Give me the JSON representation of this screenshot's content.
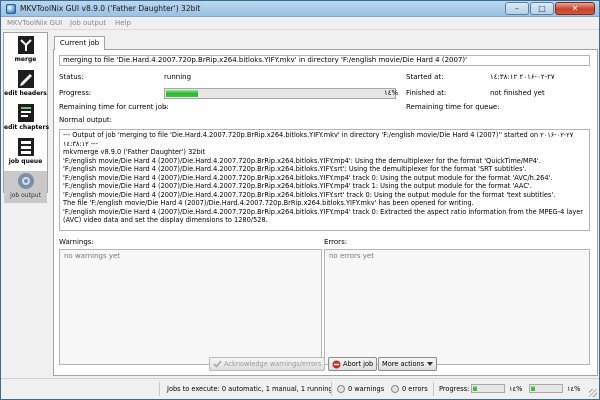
{
  "window": {
    "title": "MKVToolNix GUI v8.9.0 ('Father Daughter') 32bit",
    "minimize_glyph": "–",
    "maximize_glyph": "□",
    "close_glyph": "✕"
  },
  "menu": [
    "MKVToolNix GUI",
    "Job output",
    "Help"
  ],
  "sidebar": [
    {
      "label": "merge",
      "icon": "merge-icon"
    },
    {
      "label": "edit headers",
      "icon": "edit-headers-icon"
    },
    {
      "label": "edit chapters",
      "icon": "edit-chapters-icon"
    },
    {
      "label": "job queue",
      "icon": "job-queue-icon"
    },
    {
      "label": "job output",
      "icon": "job-output-icon",
      "active": true
    }
  ],
  "tab": {
    "label": "Current job"
  },
  "job": {
    "description": "merging to file 'Die.Hard.4.2007.720p.BrRip.x264.bitloks.YIFY.mkv' in directory 'F:/english movie/Die Hard 4 (2007)'",
    "status_label": "Status:",
    "status_value": "running",
    "progress_label": "Progress:",
    "progress_value": 0.14,
    "progress_text": "۱٤%",
    "started_label": "Started at:",
    "started_value": "۱٤:۳۸:۱۲ ۲۰۱۶-۰۲-۲۷",
    "finished_label": "Finished at:",
    "finished_value": "not finished yet",
    "remaining_current_label": "Remaining time for current job:",
    "remaining_current_value": "–",
    "remaining_queue_label": "Remaining time for queue:",
    "remaining_queue_value": "–",
    "normal_output_label": "Normal output:"
  },
  "output_lines": [
    "--- Output of job 'merging to file 'Die.Hard.4.2007.720p.BrRip.x264.bitloks.YIFY.mkv' in directory 'F:/english movie/Die Hard 4 (2007)'' started on ۲۰۱۶-۰۲-۲۷",
    "۱٤:۳۸:۱۲ ---",
    "mkvmerge v8.9.0 ('Father Daughter') 32bit",
    "'F:/english movie/Die Hard 4 (2007)/Die.Hard.4.2007.720p.BrRip.x264.bitloks.YIFY.mp4': Using the demultiplexer for the format 'QuickTime/MP4'.",
    "'F:/english movie/Die Hard 4 (2007)/Die.Hard.4.2007.720p.BrRip.x264.bitloks.YIFY.srt': Using the demultiplexer for the format 'SRT subtitles'.",
    "'F:/english movie/Die Hard 4 (2007)/Die.Hard.4.2007.720p.BrRip.x264.bitloks.YIFY.mp4' track 0: Using the output module for the format 'AVC/h.264'.",
    "'F:/english movie/Die Hard 4 (2007)/Die.Hard.4.2007.720p.BrRip.x264.bitloks.YIFY.mp4' track 1: Using the output module for the format 'AAC'.",
    "'F:/english movie/Die Hard 4 (2007)/Die.Hard.4.2007.720p.BrRip.x264.bitloks.YIFY.srt' track 0: Using the output module for the format 'text subtitles'.",
    "The file 'F:/english movie/Die Hard 4 (2007)/Die.Hard.4.2007.720p.BrRip.x264.bitloks.YIFY.mkv' has been opened for writing.",
    "'F:/english movie/Die Hard 4 (2007)/Die.Hard.4.2007.720p.BrRip.x264.bitloks.YIFY.mp4' track 0: Extracted the aspect ratio information from the MPEG-4 layer 10",
    "(AVC) video data and set the display dimensions to 1280/528."
  ],
  "warnings": {
    "label": "Warnings:",
    "empty_text": "no warnings yet"
  },
  "errors": {
    "label": "Errors:",
    "empty_text": "no errors yet"
  },
  "buttons": {
    "acknowledge": "Acknowledge warnings/errors",
    "abort": "Abort job",
    "more_actions": "More actions"
  },
  "statusbar": {
    "jobs_text": "Jobs to execute:  0 automatic, 1 manual, 1 running",
    "warnings_text": "0 warnings",
    "errors_text": "0 errors",
    "progress_label": "Progress:",
    "progress_1_value": 0.14,
    "progress_1_text": "۱٤%",
    "progress_2_value": 0.14,
    "progress_2_text": "۱٤%"
  },
  "colors": {
    "progress_green": "#29b929",
    "titlebar": "#a9cbe8",
    "abort_red": "#d22b1f"
  }
}
